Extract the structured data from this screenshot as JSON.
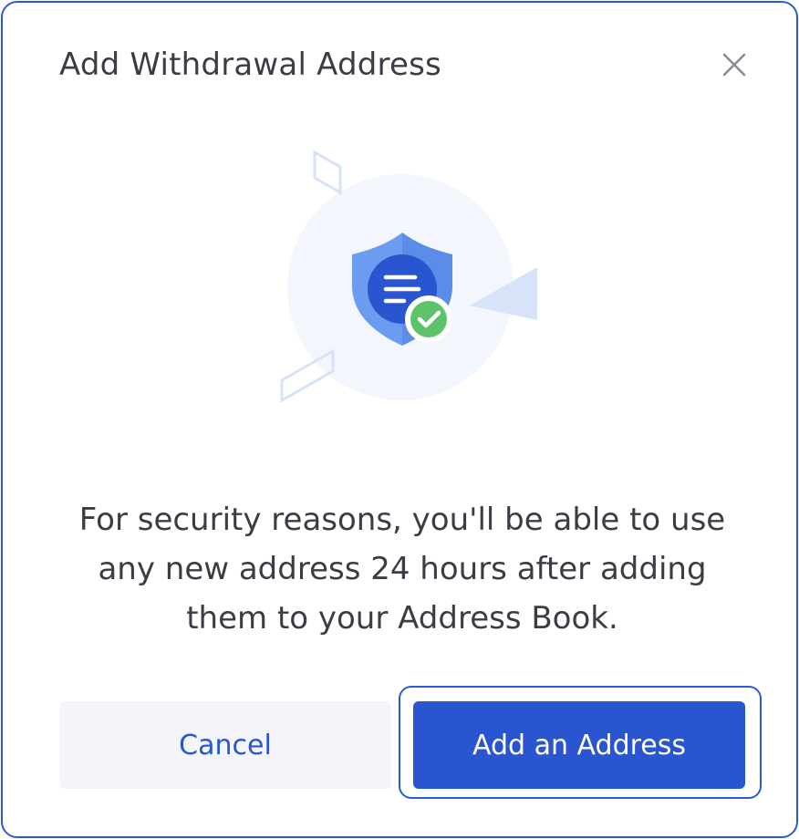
{
  "dialog": {
    "title": "Add Withdrawal Address",
    "message": "For security reasons, you'll be able to use any new address 24 hours after adding them to your Address Book.",
    "close_icon": "close-icon",
    "illustration_icon": "shield-check-icon"
  },
  "buttons": {
    "cancel_label": "Cancel",
    "primary_label": "Add an Address"
  },
  "colors": {
    "accent": "#2a55d1",
    "border": "#2a5bd7",
    "text": "#3b3d45",
    "success": "#5cc36a",
    "cancel_bg": "#f4f5fa"
  }
}
